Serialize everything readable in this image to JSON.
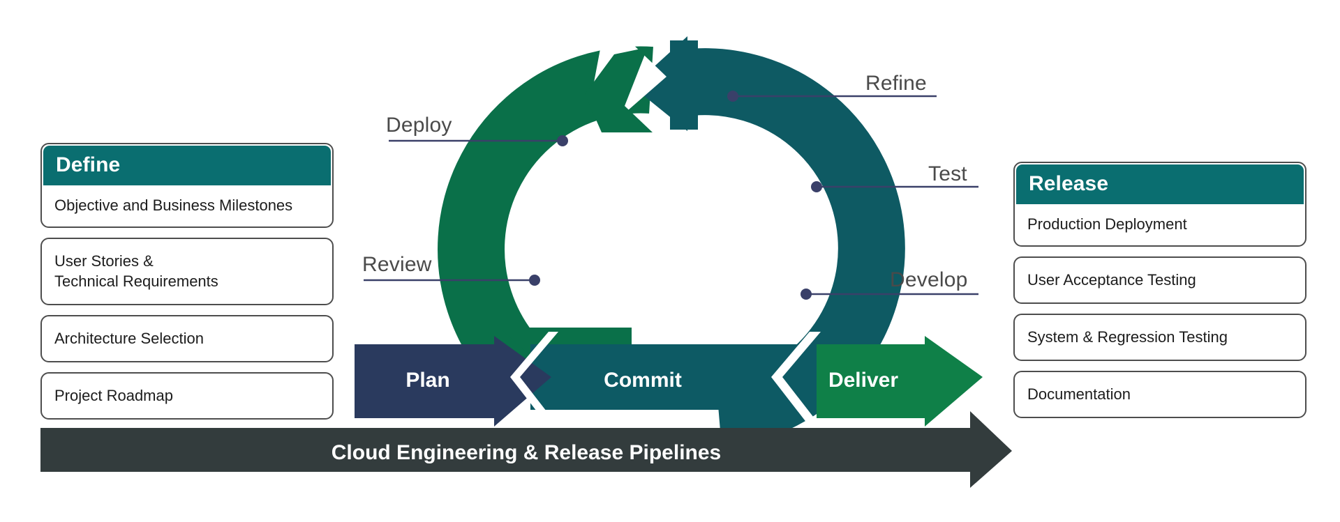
{
  "diagram": {
    "title": "Cloud Engineering & Release Pipelines",
    "colors": {
      "header_teal": "#0a6e70",
      "ring_teal": "#0e5a63",
      "ring_green": "#0a7049",
      "deliver_green": "#0f8048",
      "plan_navy": "#2a3a5e",
      "commit_teal": "#0d5a64",
      "baseline_bar": "#333c3d",
      "callout_text": "#4a4a4a",
      "connector_line": "#3a4069",
      "card_border": "#4d4d4d"
    }
  },
  "left_column": {
    "cards": [
      {
        "header": "Define",
        "body": [
          "Objective and Business Milestones"
        ]
      },
      {
        "header": null,
        "body": [
          "User Stories &",
          "Technical Requirements"
        ]
      },
      {
        "header": null,
        "body": [
          "Architecture Selection"
        ]
      },
      {
        "header": null,
        "body": [
          "Project Roadmap"
        ]
      }
    ]
  },
  "right_column": {
    "cards": [
      {
        "header": "Release",
        "body": [
          "Production Deployment"
        ]
      },
      {
        "header": null,
        "body": [
          "User Acceptance Testing"
        ]
      },
      {
        "header": null,
        "body": [
          "System & Regression Testing"
        ]
      },
      {
        "header": null,
        "body": [
          "Documentation"
        ]
      }
    ]
  },
  "cycle": {
    "callouts": [
      {
        "label": "Deploy",
        "side": "left"
      },
      {
        "label": "Review",
        "side": "left"
      },
      {
        "label": "Refine",
        "side": "right"
      },
      {
        "label": "Test",
        "side": "right"
      },
      {
        "label": "Develop",
        "side": "right"
      }
    ]
  },
  "flow_arrows": [
    {
      "label": "Plan",
      "color": "#2a3a5e"
    },
    {
      "label": "Commit",
      "color": "#0d5a64"
    },
    {
      "label": "Deliver",
      "color": "#0f8048"
    }
  ],
  "baseline": {
    "label": "Cloud Engineering & Release Pipelines"
  }
}
